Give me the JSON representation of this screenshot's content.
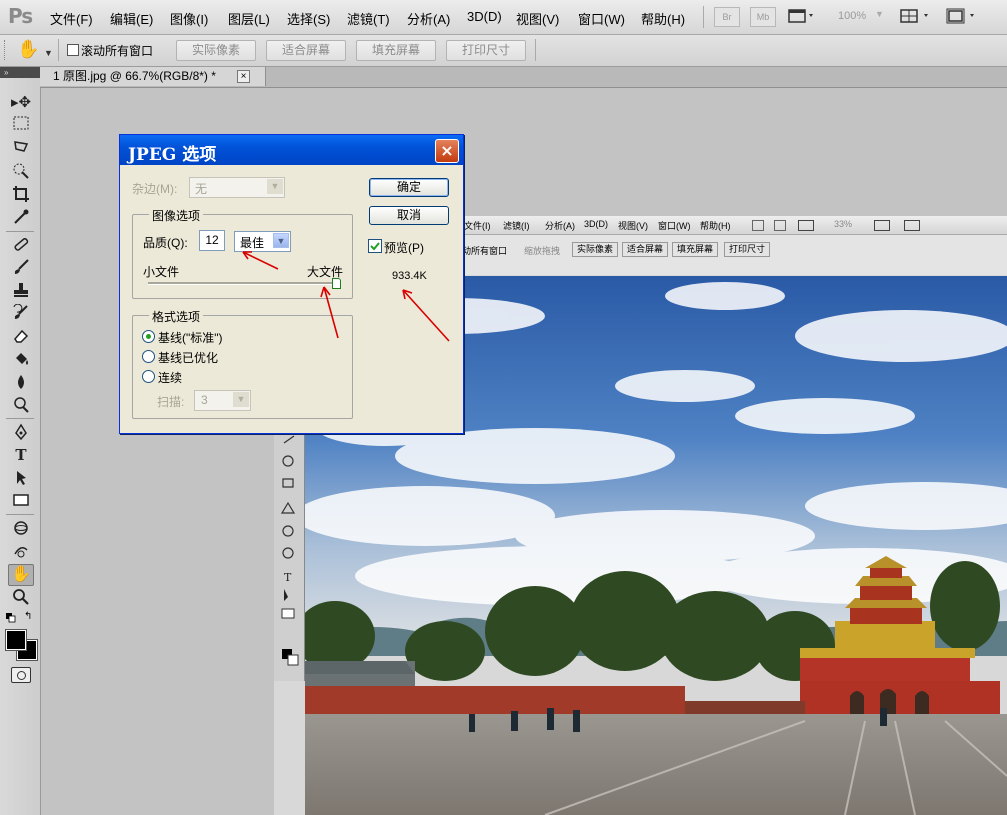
{
  "app": {
    "logo": "Ps",
    "menu": [
      "文件(F)",
      "编辑(E)",
      "图像(I)",
      "图层(L)",
      "选择(S)",
      "滤镜(T)",
      "分析(A)",
      "3D(D)",
      "视图(V)",
      "窗口(W)",
      "帮助(H)"
    ],
    "bridge_btn": "Br",
    "minibridge_btn": "Mb",
    "zoom_level": "100%"
  },
  "options_bar": {
    "scroll_all_label": "滚动所有窗口",
    "buttons": [
      "实际像素",
      "适合屏幕",
      "填充屏幕",
      "打印尺寸"
    ]
  },
  "document_tab": {
    "title": "1 原图.jpg @ 66.7%(RGB/8*) *",
    "close": "×"
  },
  "dialog": {
    "title": "JPEG  选项",
    "close": "×",
    "matte_label": "杂边(M):",
    "matte_value": "无",
    "image_options_label": "图像选项",
    "quality_label": "品质(Q):",
    "quality_value": "12",
    "quality_preset": "最佳",
    "small_file_label": "小文件",
    "large_file_label": "大文件",
    "quality_slider_fraction": 1.0,
    "format_options_label": "格式选项",
    "format_options": [
      "基线(\"标准\")",
      "基线已优化",
      "连续"
    ],
    "format_selected": 0,
    "scans_label": "扫描:",
    "scans_value": "3",
    "ok_label": "确定",
    "cancel_label": "取消",
    "preview_label": "预览(P)",
    "preview_checked": true,
    "file_size": "933.4K"
  },
  "embedded": {
    "menu": [
      "文件(I)",
      "滤镜(I)",
      "分析(A)",
      "3D(D)",
      "视图(V)",
      "窗口(W)",
      "帮助(H)"
    ],
    "options": [
      "动所有窗口",
      "缩放拖拽",
      "实际像素",
      "适合屏幕",
      "填充屏幕",
      "打印尺寸"
    ],
    "zoom": "33%"
  },
  "colors": {
    "dialog_title": "#0152d8",
    "arrow": "#d90000",
    "sky": "#2f5fa8"
  }
}
